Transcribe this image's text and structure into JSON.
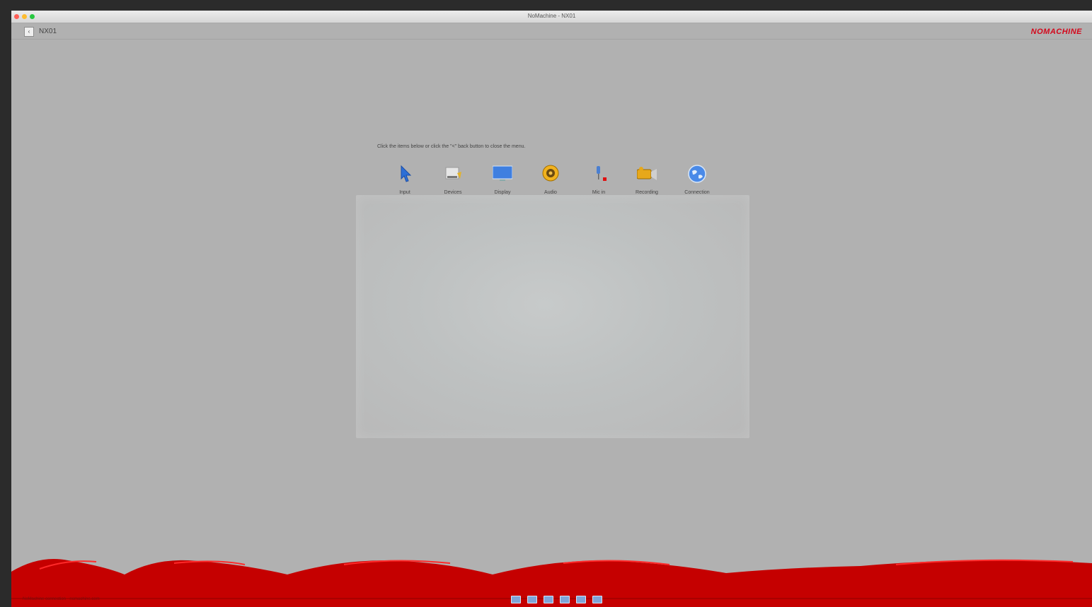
{
  "window": {
    "title": "NoMachine - NX01"
  },
  "session": {
    "name": "NX01",
    "icon": "session-icon"
  },
  "brand": {
    "name": "NOMACHINE",
    "color": "#d4071b"
  },
  "menu": {
    "hint": "Click the items below or click the \"<\" back button to close the menu.",
    "items": [
      {
        "label": "Input",
        "icon": "pointer-icon"
      },
      {
        "label": "Devices",
        "icon": "devices-icon"
      },
      {
        "label": "Display",
        "icon": "display-icon"
      },
      {
        "label": "Audio",
        "icon": "speaker-icon"
      },
      {
        "label": "Mic in",
        "icon": "microphone-icon"
      },
      {
        "label": "Recording",
        "icon": "camera-icon"
      },
      {
        "label": "Connection",
        "icon": "globe-icon"
      }
    ]
  },
  "footer": {
    "text": "NoMachine connection - nomachine.com",
    "toolbar_icons": [
      "fullscreen-icon",
      "screen-icon",
      "screen-icon",
      "screen-icon",
      "screen-icon",
      "screen-add-icon"
    ]
  },
  "colors": {
    "accent_red": "#c50000",
    "background": "#b1b1b1"
  }
}
